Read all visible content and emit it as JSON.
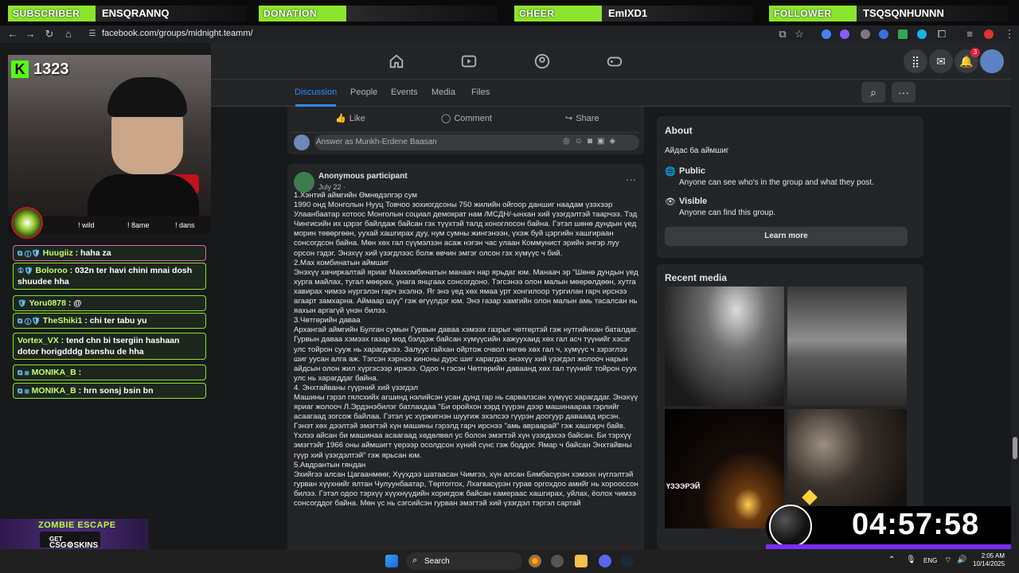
{
  "alerts": [
    {
      "label": "SUBSCRIBER",
      "name": "ENSQRANNQ"
    },
    {
      "label": "DONATION",
      "name": ""
    },
    {
      "label": "CHEER",
      "name": "EmIXD1"
    },
    {
      "label": "FOLLOWER",
      "name": "TSQSQNHUNNN"
    }
  ],
  "browser": {
    "url": "facebook.com/groups/midnight.teamm/"
  },
  "fb": {
    "notifications_badge": "3"
  },
  "tabs": [
    "Discussion",
    "People",
    "Events",
    "Media",
    "Files"
  ],
  "actions": {
    "like": "Like",
    "comment": "Comment",
    "share": "Share"
  },
  "answer_placeholder": "Answer as Munkh-Erdene Baasan",
  "post": {
    "author": "Anonymous participant",
    "date": "July 22 ·",
    "body": "1.Хэнтий аймгийн Өмнөдэлгэр сум\n1990 онд Монголын Нууц Товчоо зохиогдсоны 750 жилийн ойгоор даншиг наадам үзэхээр Улаанбаатар хотоос Монголын социал демократ нам /МСДН/-ынхан хий үзэгдэлтэй таарчээ. Тэд Чингисийн их цэрэг байлдаж байсан гэх түүхтэй талд хоноглосон байна. Гэтэл шөнө дундын үед морин төвөргөөн, уухай хашгирах дуу, нум сумны жингэнээн, үхэж буй цэргийн хашгираан сонсогдсон байна. Мөн хөх гал сүүмэлзэн асаж нэгэн час улаан Коммунист эрийн энгэр луу орсон гэдэг. Энэхүү хий үзэгдлээс болж өвчин эмгэг олсон гэх хүмүүс ч бий.\n2.Мах комбинатын аймшиг\n Энэхүү хачиркалтай яриаг Махкомбинатын манаач нар ярьдаг юм. Манаач эр \"Шөнө дундын үед хурга майлах, тугал мөөрөх, унага янцгаах сонсогдоно. Тэгсэнээ олон малын мөөрөлдөөн, хутга хавирах чимээ нүргэлэн гарч эхэлнэ. Яг энэ үед хөх ямаа урт хонгилоор тургилан гарч ирснээ агаарт замхарна. Аймаар шүү\" гэж өгүүлдэг юм. Энэ газар хамгийн олон малын амь тасалсан нь яахын аргагүй үнэн билээ.\n3.Чөтгөрийн даваа\nАрхангай аймгийн Булган сумын Гурвын даваа хэмээх газрыг чөтгөртэй гэж нутгийнхан баталдаг. Гурвын даваа хэмээх газар мод бэлдэж байсан хүмүүсийн хажуухаид хөх гал асч түүнийг хэсэг улс тойрон сууж нь харагджээ. Залуус гайхан ойртож очвол нөгөө хөх гал ч, хүмүүс ч зэрэглээ шиг уусан алга аж. Тэгсэн хэрнээ киноны дурс шиг харагдах энэхүү хий үзэгдэл жолооч нарын айдсын олон жил хүргэсээр иржээ. Одоо ч гэсэн Чөтгөрийн даваанд хөх гал түүнийг тойрон суух улс нь харагддаг байна.\n4. Энхтайваны гүүрний хий үзэгдэл\nМашины гэрэл гялсхийх агшинд нэлийсэн усан дунд гар нь сарвалзсан хүмүүс харагддаг. Энэхүү яриаг жолооч Л.Эрдэнэбилэг батлахдаа \"Би оройхон хэрд гүүрэн дээр машинаараа гэрлийг асаагаад зогсож байлаа. Гэтэл ус хүржигнэн шуугиж эхэлсээ гүүрэн доогуур давааад ирсэн. Гэнэт хөх дээлтэй эмэгтэй хүн машины гэрэлд гарч ирснээ \"амь авраарай\" гэж хашгирч байв. Үхлээ айсан би машинаа асаагаад хөдөлвөл ус болон эмэгтэй хүн үзэгдэхээ байсан. Би тэрхүү эмэгтэйг 1966 оны аймшигт үерээр осолдсон хүний сүнс гэж боддог. Ямар ч байсан Энхтайвны гүүр хий үзэгдэлтэй\" гэж ярьсан юм.\n5.Авдрантын гяндан\nЭхийгээ алсан Цагаанмөөг, Хүүхдээ шатаасан Чимгээ, хүн алсан Бямбасүрэн хэмээх нүглэлтэй гурван хүүхнийг ялтан Чулуунбаатар, Төртоггох, Лхагвасүрэн гурав оргохдоо амийг нь хорооссон билээ. Гэтэл одоо тэрхүү хүүхнүүдийн хоригдож байсан камерааc хашгирах, уйлах, ёолох чимээ сонсогддог байна. Мөн үс нь сэгсийсэн гурван эмэгтэй хий үзэгдэл тэргэл сартай"
  },
  "about": {
    "title": "About",
    "description": "Айдас ба аймшиг",
    "public_title": "Public",
    "public_desc": "Anyone can see who's in the group and what they post.",
    "visible_title": "Visible",
    "visible_desc": "Anyone can find this group.",
    "learn_more": "Learn more"
  },
  "recent_media": {
    "title": "Recent media",
    "thumb_caption": "ҮЗЭЭРЭЙ"
  },
  "stream": {
    "viewers": "1323",
    "commands": [
      "! wild",
      "! 8ame",
      "! dans"
    ],
    "chat": [
      {
        "user": "Huugiiz",
        "text": " : haha za"
      },
      {
        "user": "Boloroo",
        "text": " : 032n ter havi chini mnai dosh shuudee hha"
      },
      {
        "user": "Yoru0878",
        "text": " : @"
      },
      {
        "user": "TheShiki1",
        "text": " : chi ter tabu yu"
      },
      {
        "user": "Vortex_VX",
        "text": " : tend chn bi tsergiin hashaan dotor horigdddg bsnshu de hha"
      },
      {
        "user": "MONIKA_B",
        "text": " :"
      },
      {
        "user": "MONIKA_B",
        "text": " : hrn sonsj bsin bn"
      }
    ],
    "timer": "04:57:58",
    "promo_title": "ZOMBIE ESCAPE",
    "promo_get": "GET",
    "promo_brand": "CSG⚙SKINS"
  },
  "taskbar": {
    "search": "Search",
    "lang": "ENG",
    "time": "2:05 AM",
    "date": "10/14/2025"
  }
}
